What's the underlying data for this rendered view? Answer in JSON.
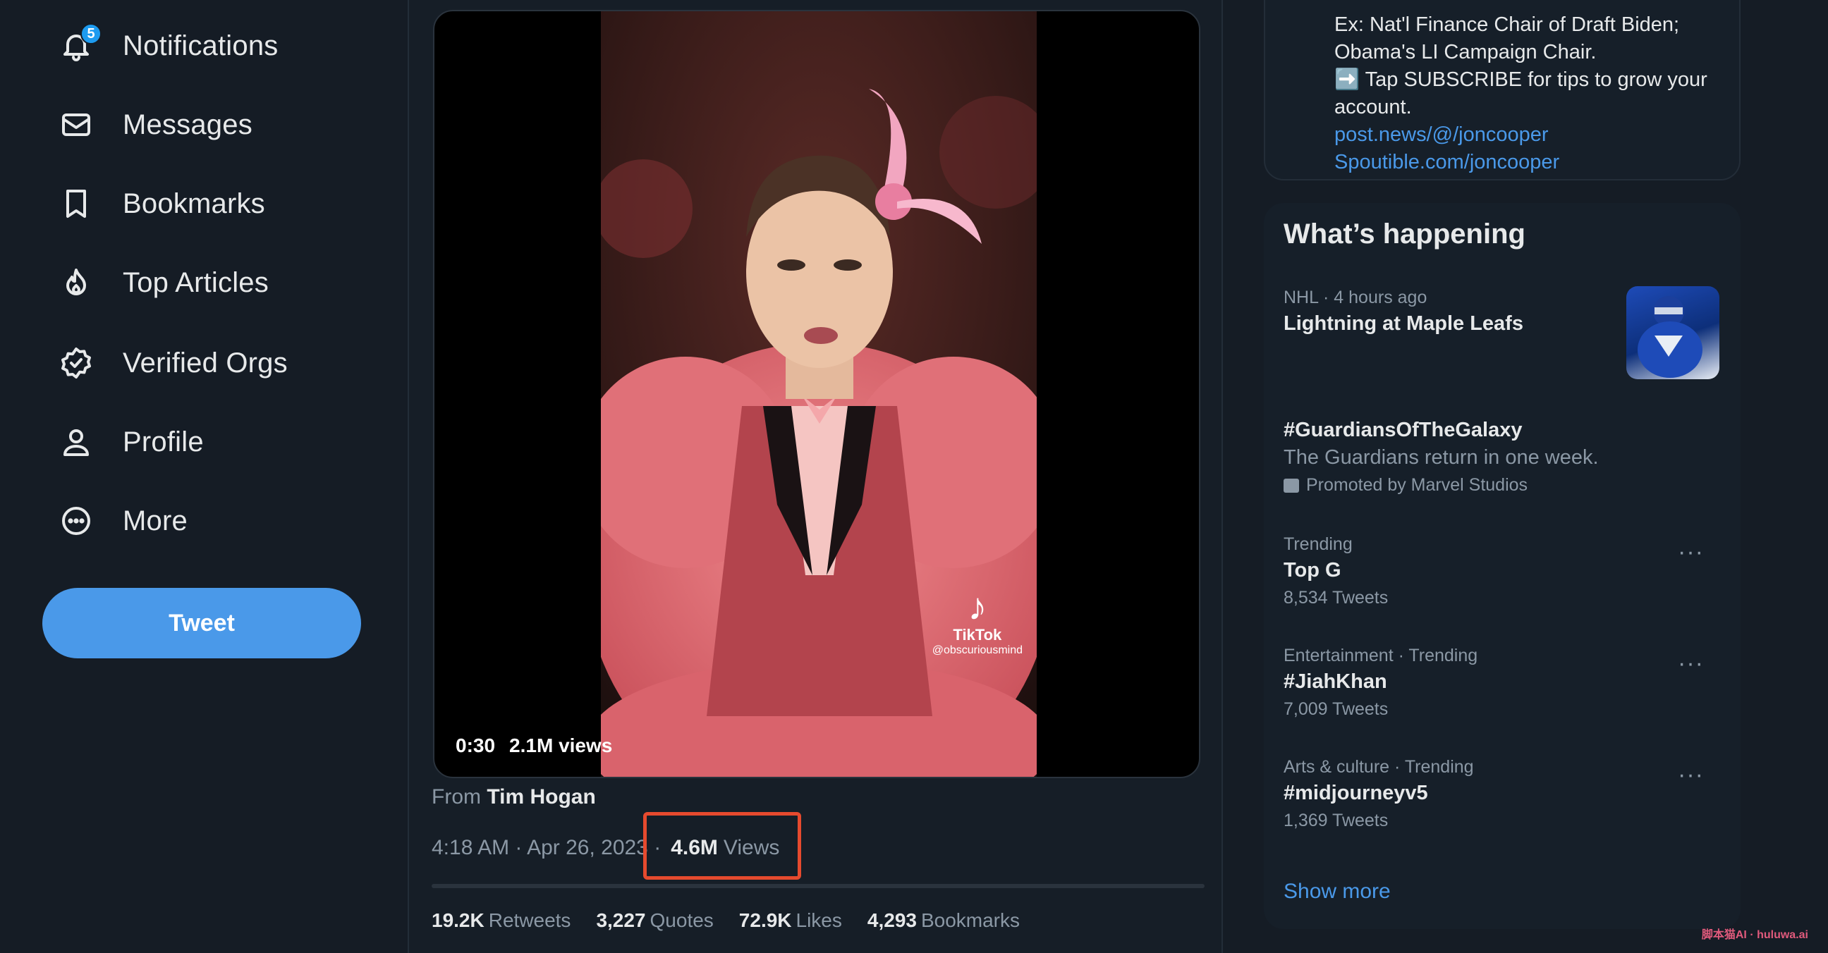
{
  "sidebar": {
    "items": [
      {
        "label": "Notifications",
        "icon": "bell-icon",
        "badge": "5"
      },
      {
        "label": "Messages",
        "icon": "envelope-icon"
      },
      {
        "label": "Bookmarks",
        "icon": "bookmark-icon"
      },
      {
        "label": "Top Articles",
        "icon": "flame-icon"
      },
      {
        "label": "Verified Orgs",
        "icon": "verified-badge-icon"
      },
      {
        "label": "Profile",
        "icon": "person-icon"
      },
      {
        "label": "More",
        "icon": "more-circle-icon"
      }
    ],
    "tweet_button": "Tweet"
  },
  "tweet": {
    "video": {
      "duration": "0:30",
      "views": "2.1M views",
      "watermark_app": "TikTok",
      "watermark_handle": "@obscuriousmind"
    },
    "from_prefix": "From",
    "from_name": "Tim Hogan",
    "timestamp": "4:18 AM · Apr 26, 2023 ·",
    "views_count": "4.6M",
    "views_label": "Views",
    "stats": [
      {
        "count": "19.2K",
        "label": "Retweets"
      },
      {
        "count": "3,227",
        "label": "Quotes"
      },
      {
        "count": "72.9K",
        "label": "Likes"
      },
      {
        "count": "4,293",
        "label": "Bookmarks"
      }
    ]
  },
  "bio": {
    "line1": "Ex: Nat'l Finance Chair of Draft Biden; Obama's LI Campaign Chair.",
    "line2": "➡️ Tap SUBSCRIBE for tips to grow your account.",
    "link1": "post.news/@/joncooper",
    "link2": "Spoutible.com/joncooper"
  },
  "trends": {
    "title": "What’s happening",
    "items": [
      {
        "meta": "NHL · 4 hours ago",
        "name": "Lightning at Maple Leafs"
      },
      {
        "name": "#GuardiansOfTheGalaxy",
        "desc": "The Guardians return in one week.",
        "promo": "Promoted by Marvel Studios"
      },
      {
        "meta": "Trending",
        "name": "Top G",
        "count": "8,534 Tweets"
      },
      {
        "meta": "Entertainment · Trending",
        "name": "#JiahKhan",
        "count": "7,009 Tweets"
      },
      {
        "meta": "Arts & culture · Trending",
        "name": "#midjourneyv5",
        "count": "1,369 Tweets"
      }
    ],
    "more_icon": "···",
    "show_more": "Show more"
  },
  "watermark": "脚本猫AI · huluwa.ai",
  "colors": {
    "accent": "#1d9bf0",
    "tweet_button": "#4a99e9",
    "highlight": "#e64a2e",
    "background": "#15202b"
  }
}
